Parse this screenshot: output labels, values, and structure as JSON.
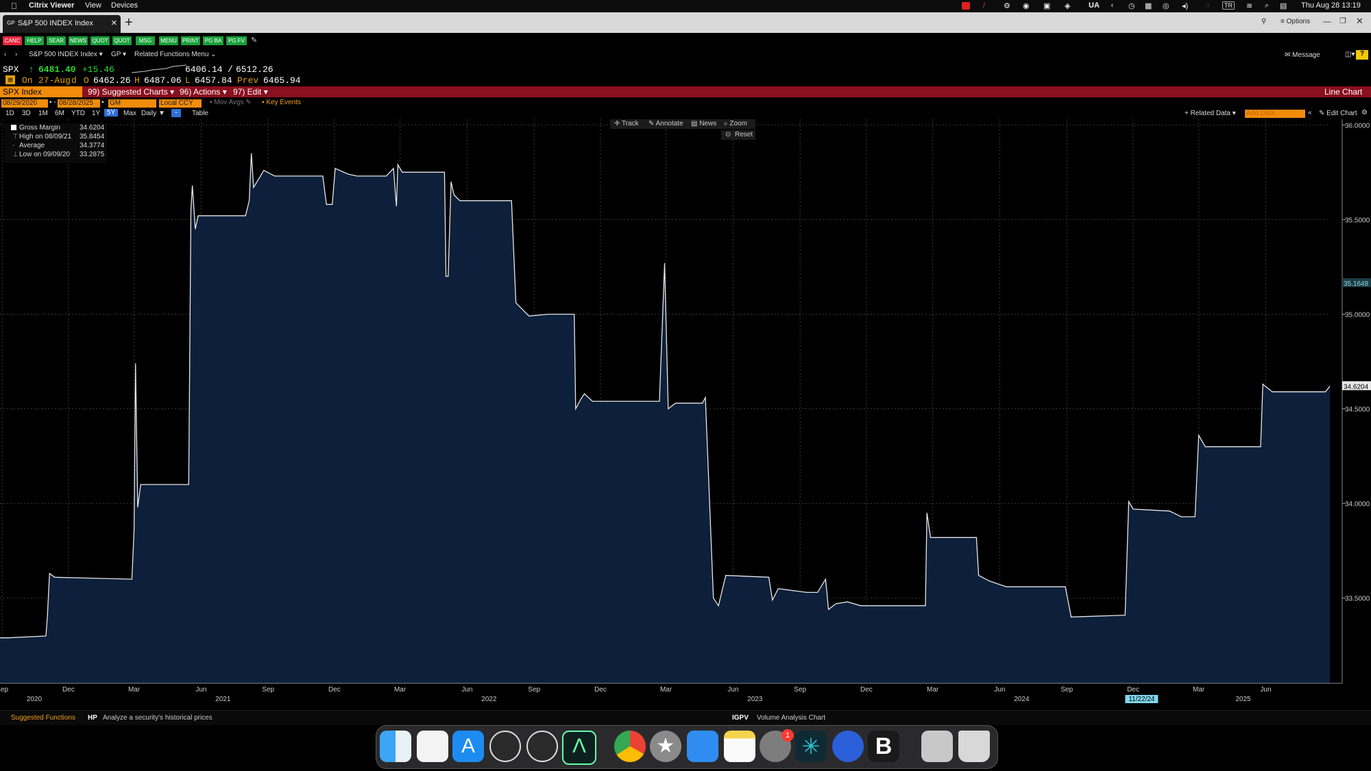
{
  "menubar": {
    "app": "Citrix Viewer",
    "items": [
      "View",
      "Devices"
    ],
    "status_ua": "UA",
    "status_tr": "TR",
    "datetime": "Thu Aug 28  13:19"
  },
  "tab": {
    "title": "S&P 500 INDEX Index",
    "close": "×",
    "new_tab": "+",
    "options": "Options"
  },
  "toolbar_buttons": [
    "CANC",
    "HELP",
    "SEAR",
    "NEWS",
    "QUOT",
    "QUOT",
    "MSG",
    "MENU",
    "PRINT",
    "PG BA",
    "PG FV"
  ],
  "nav": {
    "security": "S&P 500 INDEX Index",
    "gp": "GP",
    "related": "Related Functions Menu",
    "message": "Message"
  },
  "quote": {
    "ticker": "SPX",
    "arrow": "↑",
    "last": "6481.40",
    "change": "+15.46",
    "range_low": "6406.14",
    "range_sep": "/",
    "range_high": "6512.26",
    "on_label": "On",
    "date": "27-Aug",
    "d": "d",
    "o_label": "O",
    "open": "6462.26",
    "h_label": "H",
    "high": "6487.06",
    "l_label": "L",
    "low": "6457.84",
    "prev_label": "Prev",
    "prev": "6465.94"
  },
  "menu_bar": {
    "security": "SPX Index",
    "suggested": "99) Suggested Charts",
    "actions": "96) Actions",
    "edit": "97) Edit",
    "chart_type": "Line Chart"
  },
  "controls": {
    "start_date": "08/29/2020",
    "end_date": "08/28/2025",
    "field": "GM",
    "currency": "Local CCY",
    "mov_avgs": "Mov Avgs",
    "key_events": "Key Events",
    "periods": [
      "1D",
      "3D",
      "1M",
      "6M",
      "YTD",
      "1Y",
      "5Y",
      "Max"
    ],
    "active_period": "5Y",
    "frequency": "Daily",
    "table": "Table",
    "track": "Track",
    "annotate": "Annotate",
    "news": "News",
    "zoom": "Zoom",
    "reset": "Reset",
    "related_data": "Related Data",
    "add_data": "Add Data",
    "edit_chart": "Edit Chart"
  },
  "legend": {
    "series": "Gross Margin",
    "series_value": "34.6204",
    "high_label": "High on 08/09/21",
    "high_value": "35.8454",
    "avg_label": "Average",
    "avg_value": "34.3774",
    "low_label": "Low on 09/09/20",
    "low_value": "33.2875"
  },
  "chart_data": {
    "type": "area",
    "title": "",
    "y_ticks": [
      "36.0000",
      "35.5000",
      "35.0000",
      "34.5000",
      "34.0000",
      "33.5000"
    ],
    "y_range": [
      33.05,
      36.03
    ],
    "x_range": [
      "2020-08-29",
      "2025-08-28"
    ],
    "markers": [
      {
        "label": "35.1648",
        "value": 35.1648
      },
      {
        "label": "34.6204",
        "value": 34.6204
      }
    ],
    "x_month_ticks": [
      {
        "label": "Sep",
        "date": "2020-09-01"
      },
      {
        "label": "Dec",
        "date": "2020-12-01"
      },
      {
        "label": "Mar",
        "date": "2021-03-01"
      },
      {
        "label": "Jun",
        "date": "2021-06-01"
      },
      {
        "label": "Sep",
        "date": "2021-09-01"
      },
      {
        "label": "Dec",
        "date": "2021-12-01"
      },
      {
        "label": "Mar",
        "date": "2022-03-01"
      },
      {
        "label": "Jun",
        "date": "2022-06-01"
      },
      {
        "label": "Sep",
        "date": "2022-09-01"
      },
      {
        "label": "Dec",
        "date": "2022-12-01"
      },
      {
        "label": "Mar",
        "date": "2023-03-01"
      },
      {
        "label": "Jun",
        "date": "2023-06-01"
      },
      {
        "label": "Sep",
        "date": "2023-09-01"
      },
      {
        "label": "Dec",
        "date": "2023-12-01"
      },
      {
        "label": "Mar",
        "date": "2024-03-01"
      },
      {
        "label": "Jun",
        "date": "2024-06-01"
      },
      {
        "label": "Sep",
        "date": "2024-09-01"
      },
      {
        "label": "Dec",
        "date": "2024-12-01"
      },
      {
        "label": "Mar",
        "date": "2025-03-01"
      },
      {
        "label": "Jun",
        "date": "2025-06-01"
      }
    ],
    "x_year_ticks": [
      {
        "label": "2020",
        "date": "2020-10-15"
      },
      {
        "label": "2021",
        "date": "2021-07-01"
      },
      {
        "label": "2022",
        "date": "2022-07-01"
      },
      {
        "label": "2023",
        "date": "2023-07-01"
      },
      {
        "label": "2024",
        "date": "2024-07-01"
      },
      {
        "label": "2025",
        "date": "2025-05-01"
      }
    ],
    "x_highlight": {
      "label": "11/22/24",
      "date": "2024-11-22"
    },
    "series": [
      {
        "values": [
          [
            "2020-08-29",
            33.29
          ],
          [
            "2020-09-09",
            33.29
          ],
          [
            "2020-10-31",
            33.3
          ],
          [
            "2020-11-02",
            33.4
          ],
          [
            "2020-11-05",
            33.63
          ],
          [
            "2020-11-12",
            33.61
          ],
          [
            "2021-02-26",
            33.6
          ],
          [
            "2021-03-01",
            33.86
          ],
          [
            "2021-03-03",
            34.74
          ],
          [
            "2021-03-06",
            33.98
          ],
          [
            "2021-03-10",
            34.1
          ],
          [
            "2021-05-15",
            34.1
          ],
          [
            "2021-05-18",
            35.55
          ],
          [
            "2021-05-20",
            35.68
          ],
          [
            "2021-05-24",
            35.45
          ],
          [
            "2021-05-28",
            35.52
          ],
          [
            "2021-06-20",
            35.52
          ],
          [
            "2021-08-01",
            35.52
          ],
          [
            "2021-08-06",
            35.6
          ],
          [
            "2021-08-09",
            35.85
          ],
          [
            "2021-08-12",
            35.67
          ],
          [
            "2021-08-20",
            35.72
          ],
          [
            "2021-08-26",
            35.76
          ],
          [
            "2021-09-10",
            35.73
          ],
          [
            "2021-11-15",
            35.73
          ],
          [
            "2021-11-20",
            35.58
          ],
          [
            "2021-11-28",
            35.58
          ],
          [
            "2021-12-02",
            35.77
          ],
          [
            "2021-12-20",
            35.74
          ],
          [
            "2022-01-01",
            35.73
          ],
          [
            "2022-02-10",
            35.73
          ],
          [
            "2022-02-20",
            35.77
          ],
          [
            "2022-02-24",
            35.57
          ],
          [
            "2022-02-26",
            35.79
          ],
          [
            "2022-03-04",
            35.75
          ],
          [
            "2022-05-01",
            35.75
          ],
          [
            "2022-05-03",
            35.2
          ],
          [
            "2022-05-06",
            35.2
          ],
          [
            "2022-05-10",
            35.7
          ],
          [
            "2022-05-14",
            35.63
          ],
          [
            "2022-05-22",
            35.6
          ],
          [
            "2022-08-01",
            35.6
          ],
          [
            "2022-08-07",
            35.06
          ],
          [
            "2022-08-25",
            34.99
          ],
          [
            "2022-09-20",
            35.0
          ],
          [
            "2022-10-26",
            35.0
          ],
          [
            "2022-10-28",
            34.5
          ],
          [
            "2022-11-04",
            34.55
          ],
          [
            "2022-11-09",
            34.58
          ],
          [
            "2022-11-20",
            34.54
          ],
          [
            "2022-12-20",
            34.54
          ],
          [
            "2023-02-20",
            34.54
          ],
          [
            "2023-02-27",
            35.27
          ],
          [
            "2023-03-04",
            34.5
          ],
          [
            "2023-03-14",
            34.53
          ],
          [
            "2023-04-20",
            34.53
          ],
          [
            "2023-04-24",
            34.56
          ],
          [
            "2023-05-05",
            33.5
          ],
          [
            "2023-05-12",
            33.46
          ],
          [
            "2023-05-22",
            33.62
          ],
          [
            "2023-07-20",
            33.61
          ],
          [
            "2023-07-25",
            33.49
          ],
          [
            "2023-08-02",
            33.55
          ],
          [
            "2023-09-10",
            33.53
          ],
          [
            "2023-09-25",
            33.53
          ],
          [
            "2023-10-06",
            33.6
          ],
          [
            "2023-10-10",
            33.44
          ],
          [
            "2023-10-20",
            33.47
          ],
          [
            "2023-11-05",
            33.48
          ],
          [
            "2023-11-23",
            33.46
          ],
          [
            "2024-02-20",
            33.46
          ],
          [
            "2024-02-22",
            33.95
          ],
          [
            "2024-02-27",
            33.82
          ],
          [
            "2024-04-30",
            33.82
          ],
          [
            "2024-05-03",
            33.62
          ],
          [
            "2024-05-18",
            33.59
          ],
          [
            "2024-06-10",
            33.56
          ],
          [
            "2024-08-30",
            33.56
          ],
          [
            "2024-09-07",
            33.4
          ],
          [
            "2024-11-20",
            33.41
          ],
          [
            "2024-11-25",
            34.01
          ],
          [
            "2024-12-01",
            33.97
          ],
          [
            "2025-01-20",
            33.96
          ],
          [
            "2025-02-05",
            33.93
          ],
          [
            "2025-02-24",
            33.93
          ],
          [
            "2025-03-01",
            34.36
          ],
          [
            "2025-03-10",
            34.3
          ],
          [
            "2025-05-25",
            34.3
          ],
          [
            "2025-05-28",
            34.63
          ],
          [
            "2025-06-10",
            34.59
          ],
          [
            "2025-08-22",
            34.59
          ],
          [
            "2025-08-28",
            34.62
          ]
        ]
      }
    ]
  },
  "bottom": {
    "suggested": "Suggested Functions",
    "hp_code": "HP",
    "hp_desc": "Analyze a security's historical prices",
    "igpv_code": "IGPV",
    "igpv_desc": "Volume Analysis Chart"
  },
  "dock": {
    "badge": "1",
    "apps": [
      "finder-icon",
      "reminders-icon",
      "app-store-icon",
      "instruments-icon",
      "instruments-alt-icon",
      "terminal-icon",
      "chrome-icon",
      "star-icon",
      "keynote-icon",
      "notes-icon",
      "system-settings-icon",
      "perplexity-icon",
      "dots-app-icon",
      "bloomberg-icon",
      "preview-icon",
      "trash-icon"
    ]
  }
}
